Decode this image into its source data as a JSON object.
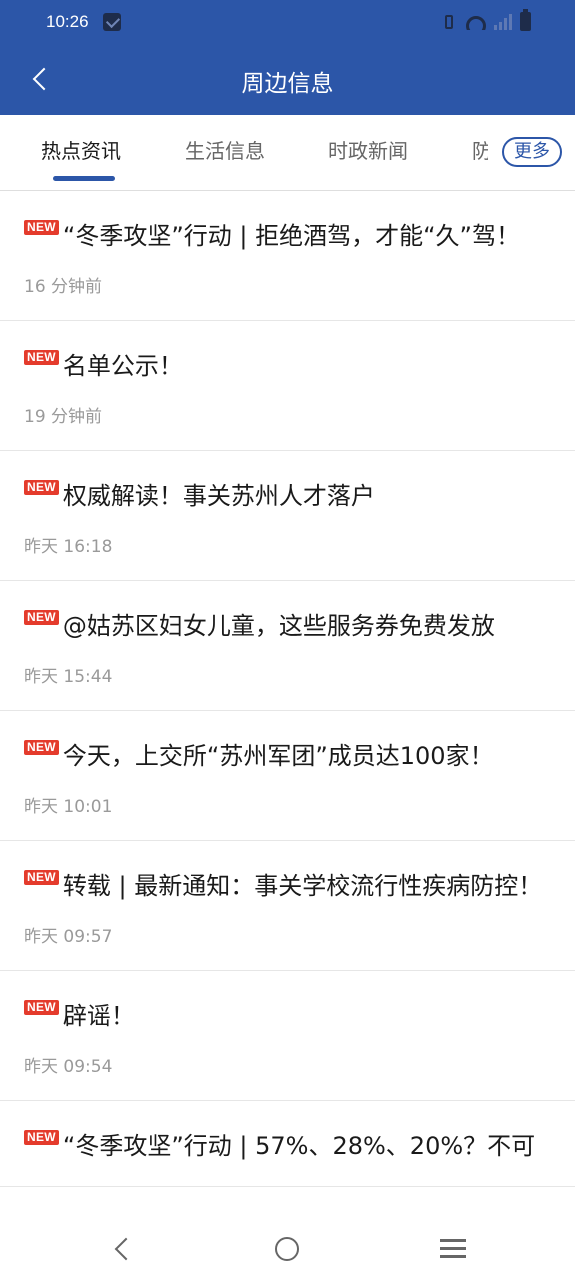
{
  "status_bar": {
    "time": "10:26",
    "icons": [
      "notification-icon",
      "vibrate-icon",
      "wifi-icon",
      "signal-icon",
      "battery-icon"
    ]
  },
  "header": {
    "title": "周边信息",
    "back_icon": "chevron-left-icon",
    "background": "#2c56a8"
  },
  "tabs": [
    {
      "label": "热点资讯",
      "active": true
    },
    {
      "label": "生活信息",
      "active": false
    },
    {
      "label": "时政新闻",
      "active": false
    },
    {
      "label": "防",
      "active": false
    }
  ],
  "more_label": "更多",
  "badge_label": "NEW",
  "colors": {
    "accent": "#2c56a8",
    "badge": "#e43b2c"
  },
  "news": [
    {
      "title": "“冬季攻坚”行动 | 拒绝酒驾，才能“久”驾！",
      "time": "16 分钟前"
    },
    {
      "title": "名单公示！",
      "time": "19 分钟前"
    },
    {
      "title": "权威解读！事关苏州人才落户",
      "time": "昨天 16:18"
    },
    {
      "title": "@姑苏区妇女儿童，这些服务券免费发放",
      "time": "昨天 15:44"
    },
    {
      "title": "今天，上交所“苏州军团”成员达100家！",
      "time": "昨天 10:01"
    },
    {
      "title": "转载 | 最新通知：事关学校流行性疾病防控！",
      "time": "昨天 09:57"
    },
    {
      "title": "辟谣！",
      "time": "昨天 09:54"
    },
    {
      "title": "“冬季攻坚”行动 | 57%、28%、20%？不可",
      "time": ""
    }
  ],
  "nav_icons": [
    "back-triangle-icon",
    "home-circle-icon",
    "menu-lines-icon"
  ]
}
